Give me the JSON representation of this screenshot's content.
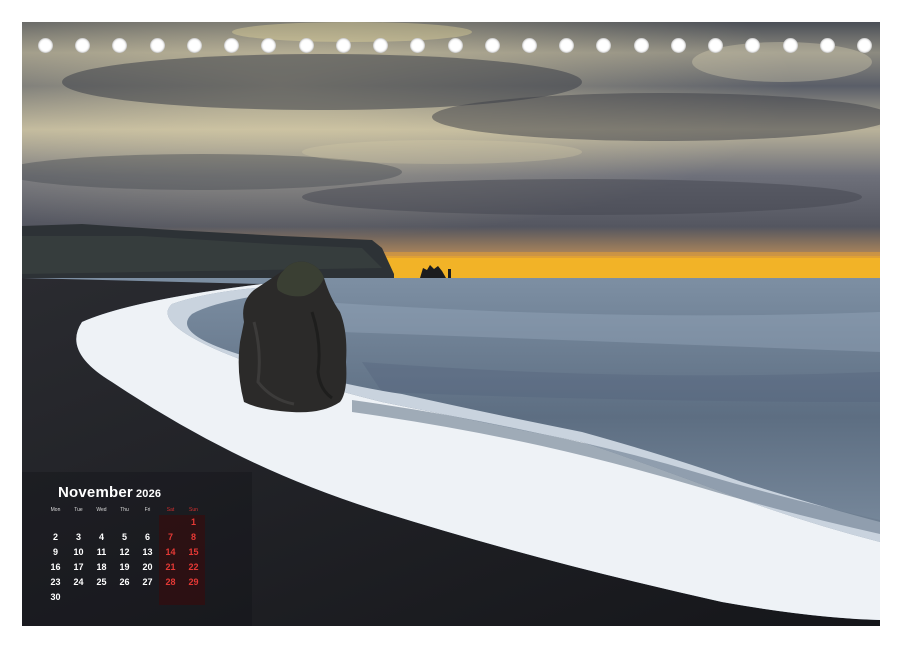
{
  "calendar": {
    "month": "November",
    "year": "2026",
    "weekday_headers": [
      "Mon",
      "Tue",
      "Wed",
      "Thu",
      "Fri",
      "Sat",
      "Sun"
    ],
    "weeks": [
      [
        "",
        "",
        "",
        "",
        "",
        "",
        "1"
      ],
      [
        "2",
        "3",
        "4",
        "5",
        "6",
        "7",
        "8"
      ],
      [
        "9",
        "10",
        "11",
        "12",
        "13",
        "14",
        "15"
      ],
      [
        "16",
        "17",
        "18",
        "19",
        "20",
        "21",
        "22"
      ],
      [
        "23",
        "24",
        "25",
        "26",
        "27",
        "28",
        "29"
      ],
      [
        "30",
        "",
        "",
        "",
        "",
        "",
        ""
      ]
    ]
  },
  "binding_holes_count": 23,
  "colors": {
    "weekend": "#d32f2f",
    "sunset": "#f5b41e",
    "sand": "#1b1c1f"
  }
}
